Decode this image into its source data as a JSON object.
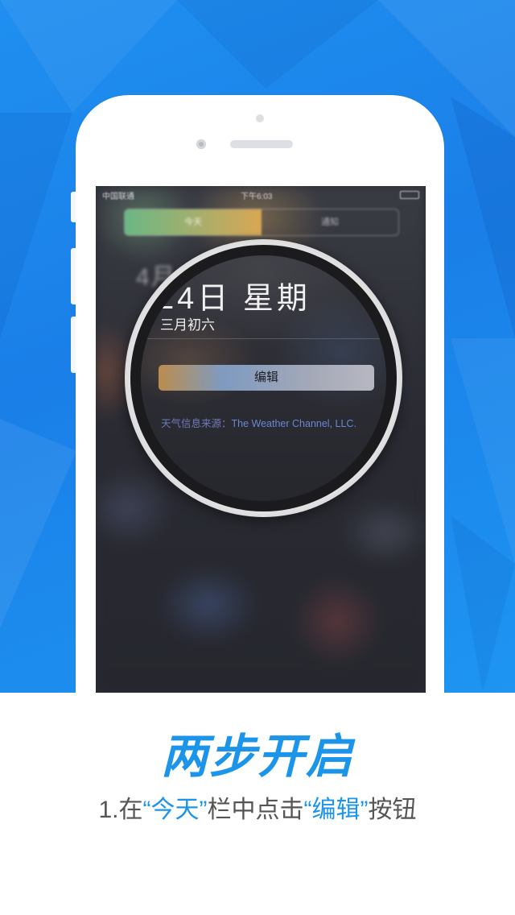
{
  "colors": {
    "accent": "#1b94ea",
    "background_blue": "#1a7fe8",
    "text_gray": "#555555"
  },
  "status_bar": {
    "carrier": "中国联通",
    "time": "下午6:03"
  },
  "notification_center": {
    "tabs": [
      {
        "label": "今天",
        "selected": true
      },
      {
        "label": "通知",
        "selected": false
      }
    ],
    "date_line": "4月24日 星期五",
    "lunar_line": "三月初六"
  },
  "magnifier": {
    "date_text": "24日 星期",
    "lunar_text": "三月初六",
    "edit_button_label": "编辑",
    "weather_source_label": "天气信息来源：",
    "weather_source_name": "The Weather Channel, LLC."
  },
  "caption": {
    "headline": "两步开启",
    "step_prefix": "1.在",
    "step_tab": "“今天”",
    "step_middle": "栏中点击",
    "step_button": "“编辑”",
    "step_suffix": "按钮"
  }
}
